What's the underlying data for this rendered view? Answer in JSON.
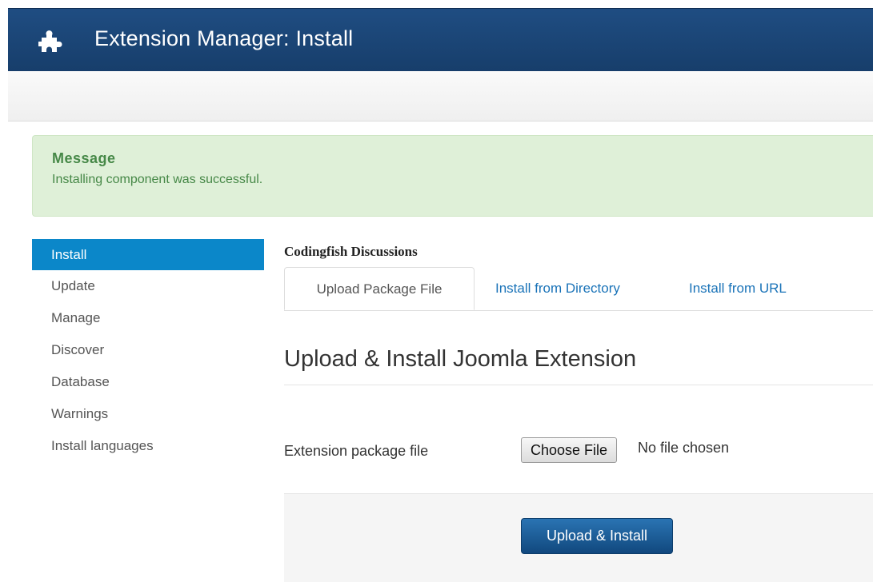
{
  "header": {
    "title": "Extension Manager: Install",
    "icon": "puzzle-piece-icon"
  },
  "message": {
    "heading": "Message",
    "text": "Installing component was successful.",
    "color": "#468847",
    "background": "#dff0d8"
  },
  "sidebar": {
    "items": [
      {
        "label": "Install",
        "active": true
      },
      {
        "label": "Update"
      },
      {
        "label": "Manage"
      },
      {
        "label": "Discover"
      },
      {
        "label": "Database"
      },
      {
        "label": "Warnings"
      },
      {
        "label": "Install languages"
      }
    ],
    "active_color": "#0b87c9"
  },
  "content": {
    "subtitle": "Codingfish Discussions",
    "tabs": [
      {
        "label": "Upload Package File",
        "active": true
      },
      {
        "label": "Install from Directory"
      },
      {
        "label": "Install from URL"
      }
    ],
    "section_title": "Upload & Install Joomla Extension",
    "field_label": "Extension package file",
    "choose_file_label": "Choose File",
    "no_file_text": "No file chosen",
    "submit_label": "Upload & Install"
  },
  "colors": {
    "header": "#1f4d82",
    "link": "#1a73b8",
    "primary_button": "#1d5f9c"
  }
}
